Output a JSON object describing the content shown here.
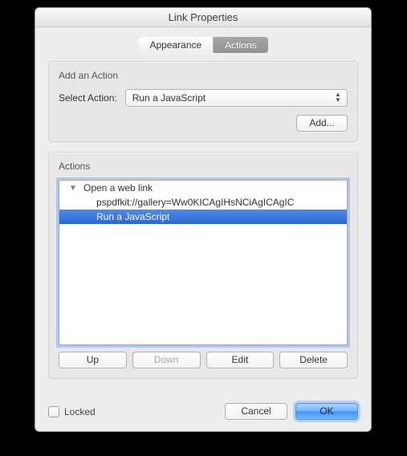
{
  "window": {
    "title": "Link Properties"
  },
  "tabs": {
    "appearance": "Appearance",
    "actions": "Actions"
  },
  "addAction": {
    "groupLabel": "Add an Action",
    "selectLabel": "Select Action:",
    "selectValue": "Run a JavaScript",
    "addButton": "Add..."
  },
  "actions": {
    "groupLabel": "Actions",
    "items": {
      "parent": "Open a web link",
      "child": "pspdfkit://gallery=Ww0KICAgIHsNCiAgICAgIC",
      "selected": "Run a JavaScript"
    },
    "buttons": {
      "up": "Up",
      "down": "Down",
      "edit": "Edit",
      "delete": "Delete"
    }
  },
  "footer": {
    "locked": "Locked",
    "cancel": "Cancel",
    "ok": "OK"
  }
}
